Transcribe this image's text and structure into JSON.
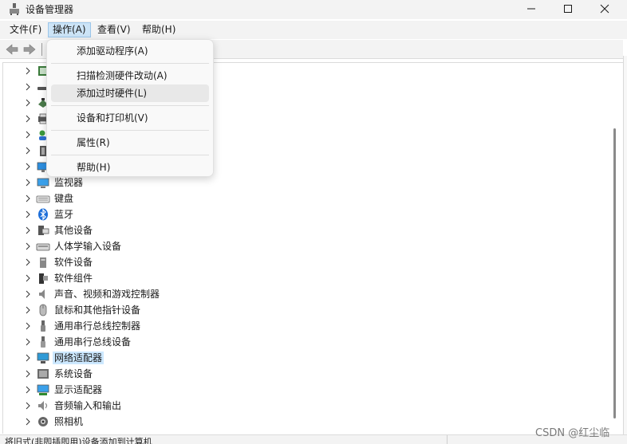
{
  "window": {
    "title": "设备管理器"
  },
  "menubar": {
    "file": "文件(F)",
    "action": "操作(A)",
    "view": "查看(V)",
    "help": "帮助(H)"
  },
  "action_menu": {
    "items": [
      "添加驱动程序(A)",
      "扫描检测硬件改动(A)",
      "添加过时硬件(L)",
      "设备和打印机(V)",
      "属性(R)",
      "帮助(H)"
    ],
    "hovered": "添加过时硬件(L)"
  },
  "tree": {
    "items": [
      {
        "label": "",
        "icon": "processor-icon"
      },
      {
        "label": "",
        "icon": "disk-drive-icon"
      },
      {
        "label": "",
        "icon": "storage-controller-icon"
      },
      {
        "label": "",
        "icon": "print-queue-icon"
      },
      {
        "label": "",
        "icon": "user-management-icon"
      },
      {
        "label": "",
        "icon": "firmware-icon"
      },
      {
        "label": "",
        "icon": "computer-icon"
      },
      {
        "label": "监视器",
        "icon": "monitor-icon"
      },
      {
        "label": "键盘",
        "icon": "keyboard-icon"
      },
      {
        "label": "蓝牙",
        "icon": "bluetooth-icon"
      },
      {
        "label": "其他设备",
        "icon": "other-devices-icon"
      },
      {
        "label": "人体学输入设备",
        "icon": "hid-icon"
      },
      {
        "label": "软件设备",
        "icon": "software-device-icon"
      },
      {
        "label": "软件组件",
        "icon": "software-component-icon"
      },
      {
        "label": "声音、视频和游戏控制器",
        "icon": "speaker-icon"
      },
      {
        "label": "鼠标和其他指针设备",
        "icon": "mouse-icon"
      },
      {
        "label": "通用串行总线控制器",
        "icon": "usb-icon"
      },
      {
        "label": "通用串行总线设备",
        "icon": "usb-device-icon"
      },
      {
        "label": "网络适配器",
        "icon": "network-adapter-icon",
        "selected": true
      },
      {
        "label": "系统设备",
        "icon": "system-device-icon"
      },
      {
        "label": "显示适配器",
        "icon": "display-adapter-icon"
      },
      {
        "label": "音频输入和输出",
        "icon": "audio-io-icon"
      },
      {
        "label": "照相机",
        "icon": "camera-icon"
      }
    ]
  },
  "statusbar": {
    "text": "将旧式(非即插即用)设备添加到计算机"
  },
  "watermark": "CSDN @红尘临",
  "colors": {
    "selection": "#cce8ff",
    "menu_active": "#cce4f7",
    "bluetooth": "#1e6fd9"
  }
}
